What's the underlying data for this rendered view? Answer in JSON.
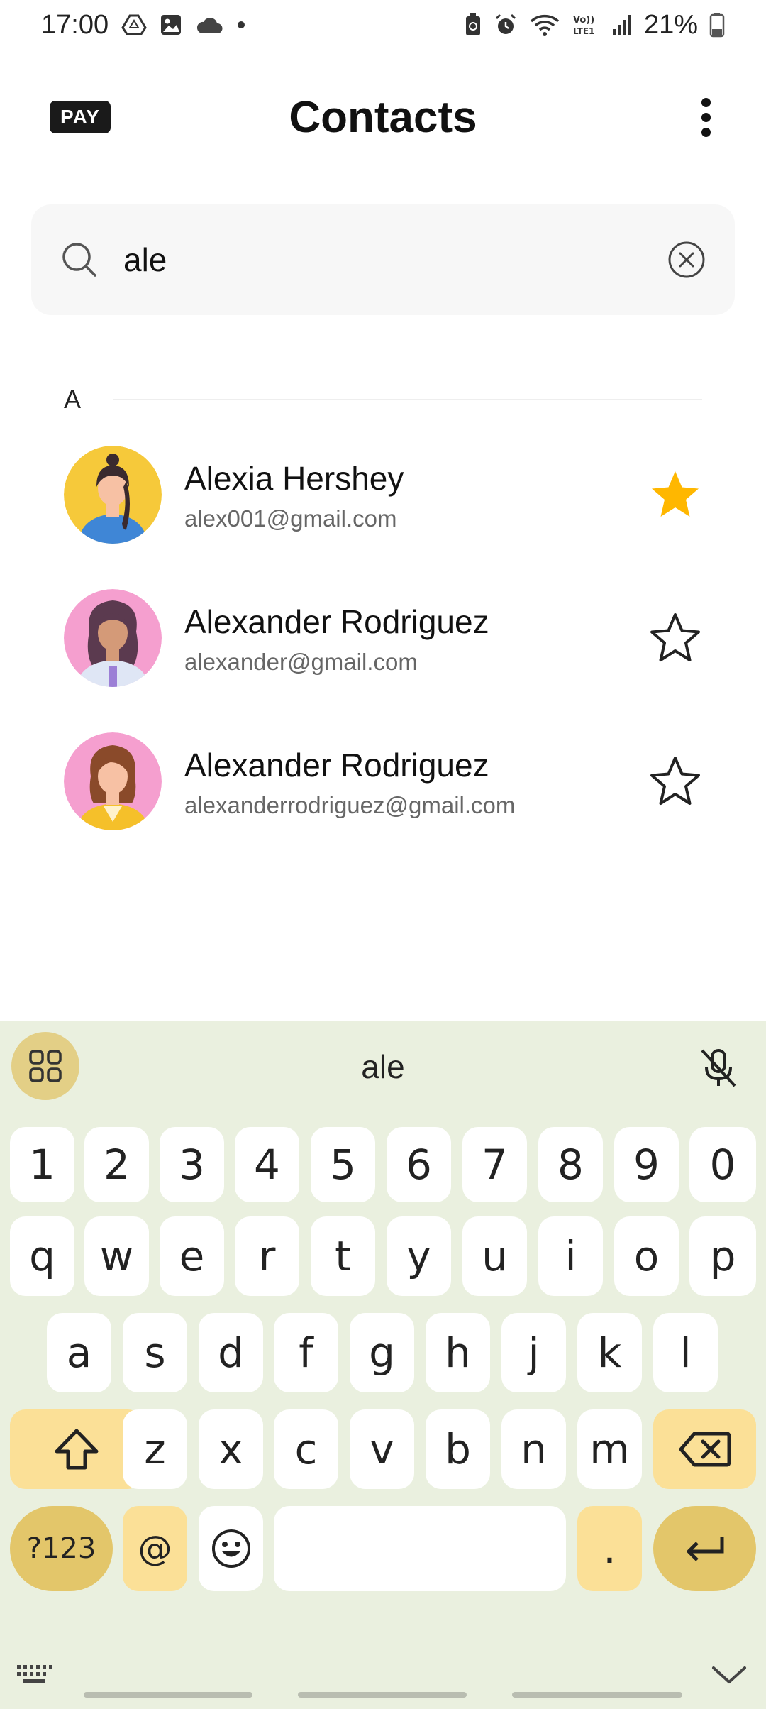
{
  "status": {
    "time": "17:00",
    "battery": "21%"
  },
  "header": {
    "pay_label": "PAY",
    "title": "Contacts"
  },
  "search": {
    "value": "ale"
  },
  "section": {
    "letter": "A"
  },
  "contacts": [
    {
      "name": "Alexia Hershey",
      "email": "alex001@gmail.com",
      "starred": true
    },
    {
      "name": "Alexander Rodriguez",
      "email": "alexander@gmail.com",
      "starred": false
    },
    {
      "name": "Alexander Rodriguez",
      "email": "alexanderrodriguez@gmail.com",
      "starred": false
    }
  ],
  "keyboard": {
    "suggestion": "ale",
    "row_numbers": [
      "1",
      "2",
      "3",
      "4",
      "5",
      "6",
      "7",
      "8",
      "9",
      "0"
    ],
    "row1": [
      "q",
      "w",
      "e",
      "r",
      "t",
      "y",
      "u",
      "i",
      "o",
      "p"
    ],
    "row2": [
      "a",
      "s",
      "d",
      "f",
      "g",
      "h",
      "j",
      "k",
      "l"
    ],
    "row3": [
      "z",
      "x",
      "c",
      "v",
      "b",
      "n",
      "m"
    ],
    "symbols_label": "?123",
    "at_label": "@",
    "period_label": "."
  },
  "colors": {
    "star_filled": "#FFB700",
    "keyboard_bg": "#eaf0df",
    "accent_key": "#fbe097"
  }
}
